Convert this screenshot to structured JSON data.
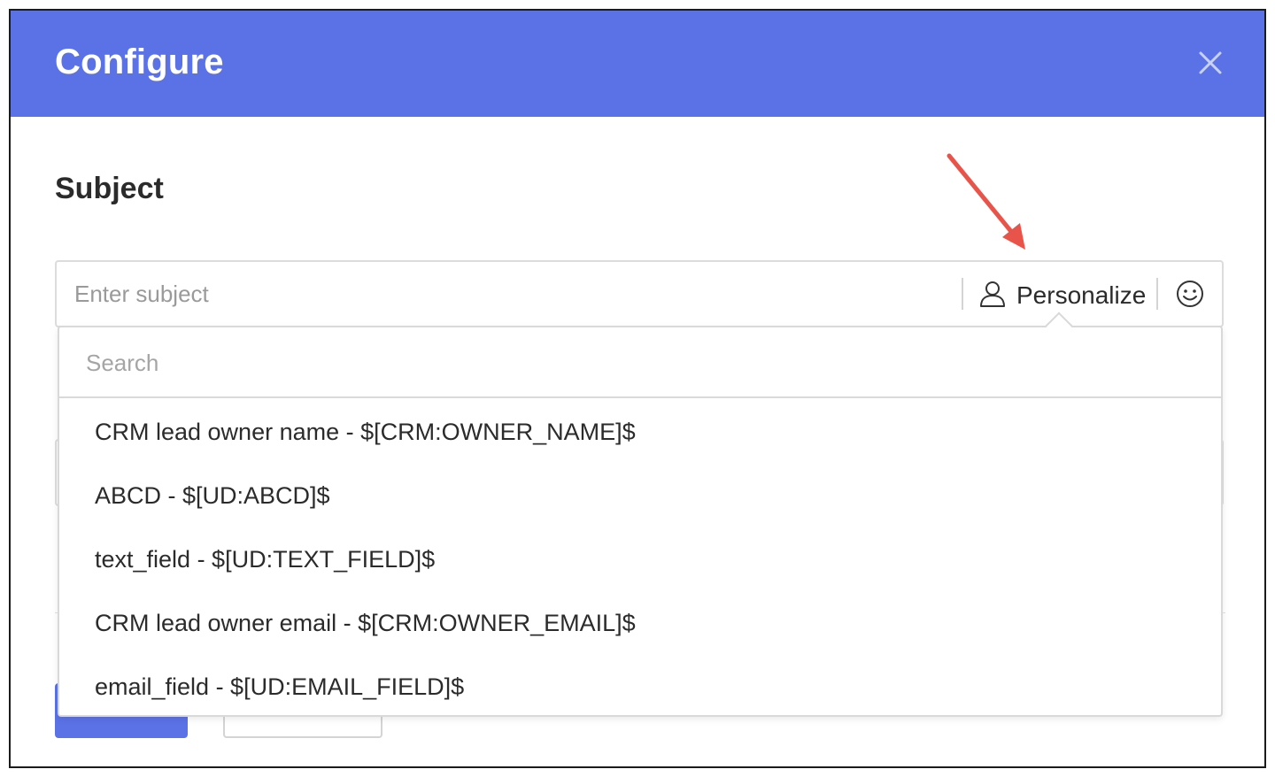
{
  "dialog": {
    "title": "Configure"
  },
  "subject": {
    "label": "Subject",
    "placeholder": "Enter subject",
    "value": "",
    "personalize_label": "Personalize"
  },
  "personalize_menu": {
    "search_placeholder": "Search",
    "options": [
      "CRM lead owner name - $[CRM:OWNER_NAME]$",
      "ABCD - $[UD:ABCD]$",
      "text_field - $[UD:TEXT_FIELD]$",
      "CRM lead owner email - $[CRM:OWNER_EMAIL]$",
      "email_field - $[UD:EMAIL_FIELD]$"
    ]
  },
  "icons": {
    "close": "close-icon",
    "personalize": "person-icon",
    "emoji": "smiley-icon",
    "annotation": "red-arrow"
  },
  "colors": {
    "header": "#5b72e6",
    "primary_button": "#5b72e6",
    "annotation_arrow": "#e8544a"
  }
}
